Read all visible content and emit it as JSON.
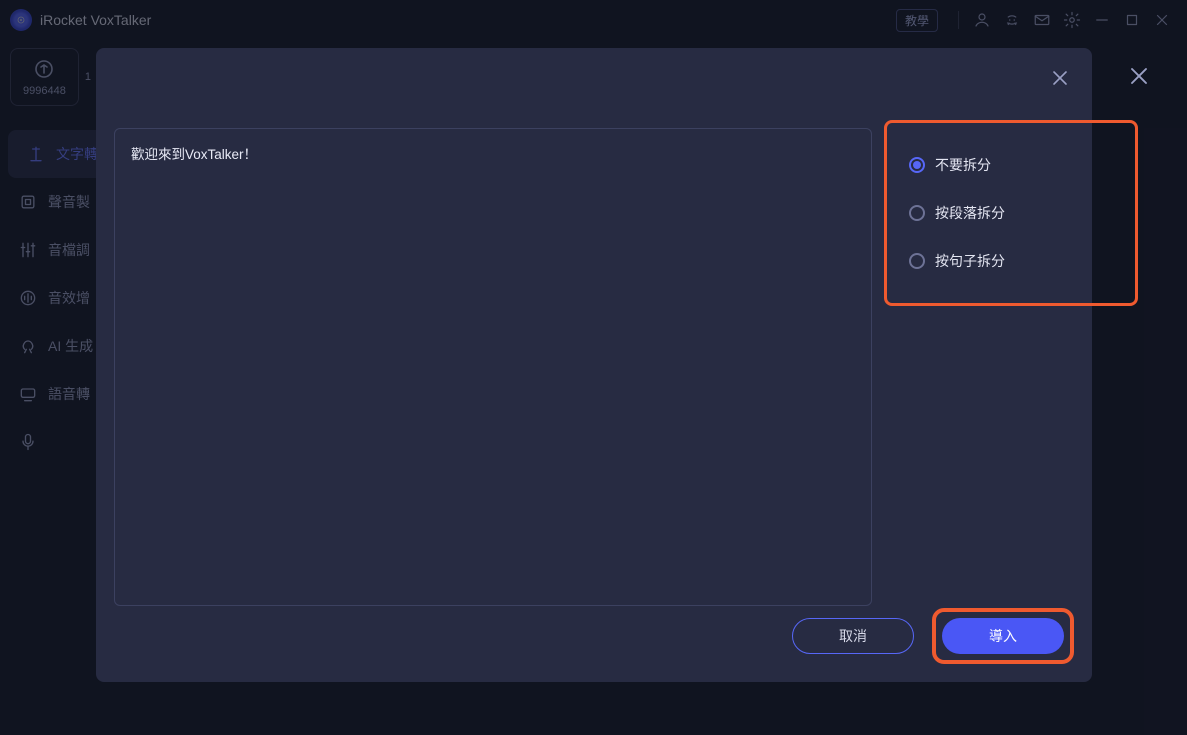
{
  "app": {
    "title": "iRocket VoxTalker",
    "tutorial_label": "教學"
  },
  "credits": {
    "value": "9996448",
    "extra": "1"
  },
  "sidebar": {
    "items": [
      {
        "label": "文字轉"
      },
      {
        "label": "聲音製"
      },
      {
        "label": "音檔調"
      },
      {
        "label": "音效增"
      },
      {
        "label": "AI 生成"
      },
      {
        "label": "語音轉"
      }
    ]
  },
  "modal": {
    "welcome_text": "歡迎來到VoxTalker！",
    "split_options": [
      {
        "label": "不要拆分",
        "selected": true
      },
      {
        "label": "按段落拆分",
        "selected": false
      },
      {
        "label": "按句子拆分",
        "selected": false
      }
    ],
    "cancel_label": "取消",
    "import_label": "導入"
  },
  "colors": {
    "accent": "#4a57f5",
    "highlight": "#ef5a2f",
    "panel": "#272b42"
  }
}
